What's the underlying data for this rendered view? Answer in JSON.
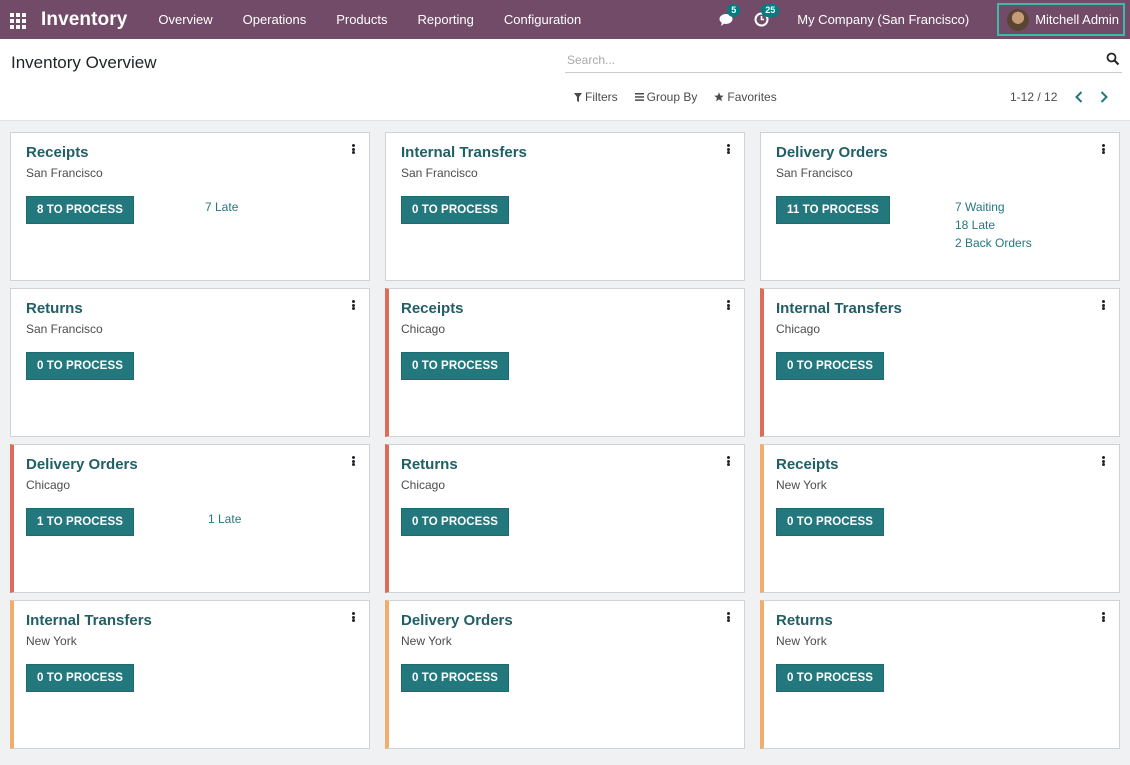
{
  "nav": {
    "brand": "Inventory",
    "menu": [
      "Overview",
      "Operations",
      "Products",
      "Reporting",
      "Configuration"
    ],
    "messages_badge": "5",
    "activities_badge": "25",
    "company": "My Company (San Francisco)",
    "user": "Mitchell Admin",
    "bar_color": "#714b67"
  },
  "control": {
    "title": "Inventory Overview",
    "search_placeholder": "Search...",
    "filters": "Filters",
    "group_by": "Group By",
    "favorites": "Favorites",
    "pager": "1-12 / 12"
  },
  "accent_colors": {
    "none": "#d0d2d5",
    "red": "#dd6c5a",
    "orange": "#f0ad6c",
    "button": "#23787e"
  },
  "cards": [
    {
      "title": "Receipts",
      "location": "San Francisco",
      "button": "8 TO PROCESS",
      "accent": "none",
      "stats": [
        "7 Late"
      ]
    },
    {
      "title": "Internal Transfers",
      "location": "San Francisco",
      "button": "0 TO PROCESS",
      "accent": "none",
      "stats": []
    },
    {
      "title": "Delivery Orders",
      "location": "San Francisco",
      "button": "11 TO PROCESS",
      "accent": "none",
      "stats": [
        "7 Waiting",
        "18 Late",
        "2 Back Orders"
      ]
    },
    {
      "title": "Returns",
      "location": "San Francisco",
      "button": "0 TO PROCESS",
      "accent": "none",
      "stats": []
    },
    {
      "title": "Receipts",
      "location": "Chicago",
      "button": "0 TO PROCESS",
      "accent": "red",
      "stats": []
    },
    {
      "title": "Internal Transfers",
      "location": "Chicago",
      "button": "0 TO PROCESS",
      "accent": "red",
      "stats": []
    },
    {
      "title": "Delivery Orders",
      "location": "Chicago",
      "button": "1 TO PROCESS",
      "accent": "red",
      "stats": [
        "1 Late"
      ]
    },
    {
      "title": "Returns",
      "location": "Chicago",
      "button": "0 TO PROCESS",
      "accent": "red",
      "stats": []
    },
    {
      "title": "Receipts",
      "location": "New York",
      "button": "0 TO PROCESS",
      "accent": "orange",
      "stats": []
    },
    {
      "title": "Internal Transfers",
      "location": "New York",
      "button": "0 TO PROCESS",
      "accent": "orange",
      "stats": []
    },
    {
      "title": "Delivery Orders",
      "location": "New York",
      "button": "0 TO PROCESS",
      "accent": "orange",
      "stats": []
    },
    {
      "title": "Returns",
      "location": "New York",
      "button": "0 TO PROCESS",
      "accent": "orange",
      "stats": []
    }
  ]
}
